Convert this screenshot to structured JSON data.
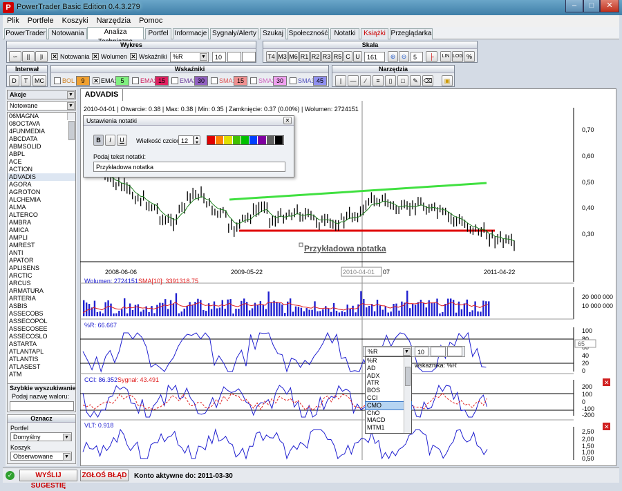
{
  "window": {
    "title": "PowerTrader Basic Edition 0.4.3.279"
  },
  "menu": [
    "Plik",
    "Portfele",
    "Koszyki",
    "Narzędzia",
    "Pomoc"
  ],
  "tabs": [
    "PowerTrader",
    "Notowania",
    "Analiza Techniczna",
    "Portfel",
    "Informacje",
    "Sygnały/Alerty",
    "Szukaj",
    "Społeczność",
    "Notatki",
    "Książki",
    "Przeglądarka"
  ],
  "wykres": {
    "title": "Wykres",
    "notowania": "Notowania",
    "wolumen": "Wolumen",
    "wskazniki": "Wskaźniki",
    "indicator": "%R",
    "period": "10"
  },
  "skala": {
    "title": "Skala",
    "buttons": [
      "T4",
      "M3",
      "M6",
      "R1",
      "R2",
      "R3",
      "R5",
      "C",
      "U"
    ],
    "count": "161",
    "zoom": "5",
    "lin": "LIN",
    "log": "LOG",
    "pct": "%"
  },
  "interwal": {
    "title": "Interwał",
    "buttons": [
      "D",
      "T",
      "MC"
    ]
  },
  "wskazniki_bar": {
    "title": "Wskaźniki",
    "items": [
      {
        "label": "BOL",
        "value": "9",
        "color": "#f0a030"
      },
      {
        "label": "EMA1",
        "value": "5",
        "color": "#70e070"
      },
      {
        "label": "EMA2",
        "value": "15",
        "color": "#e02060"
      },
      {
        "label": "EMA3",
        "value": "30",
        "color": "#9060c0"
      },
      {
        "label": "SMA1",
        "value": "15",
        "color": "#f07070"
      },
      {
        "label": "SMA2",
        "value": "30",
        "color": "#f080e0"
      },
      {
        "label": "SMA3",
        "value": "45",
        "color": "#7070e0"
      }
    ]
  },
  "narzedzia": {
    "title": "Narzędzia"
  },
  "left": {
    "akcje": "Akcje",
    "filter": "Notowane",
    "stocks": [
      "06MAGNA",
      "08OCTAVA",
      "4FUNMEDIA",
      "ABCDATA",
      "ABMSOLID",
      "ABPL",
      "ACE",
      "ACTION",
      "ADVADIS",
      "AGORA",
      "AGROTON",
      "ALCHEMIA",
      "ALMA",
      "ALTERCO",
      "AMBRA",
      "AMICA",
      "AMPLI",
      "AMREST",
      "ANTI",
      "APATOR",
      "APLISENS",
      "ARCTIC",
      "ARCUS",
      "ARMATURA",
      "ARTERIA",
      "ASBIS",
      "ASSECOBS",
      "ASSECOPOL",
      "ASSECOSEE",
      "ASSECOSLO",
      "ASTARTA",
      "ATLANTAPL",
      "ATLANTIS",
      "ATLASEST",
      "ATM"
    ],
    "selected": "ADVADIS",
    "quick_title": "Szybkie wyszukiwanie",
    "quick_prompt": "Podaj nazwę waloru:",
    "oznacz": "Oznacz",
    "portfel_label": "Portfel",
    "portfel_value": "Domyślny",
    "koszyk_label": "Koszyk",
    "koszyk_value": "Obserwowane"
  },
  "chart": {
    "tab": "ADVADIS",
    "info": "2010-04-01 | Otwarcie: 0.38 | Max: 0.38 | Min: 0.35 | Zamknięcie: 0.37 (0.00%) | Wolumen: 2724151",
    "yticks": [
      "0,70",
      "0,60",
      "0,50",
      "0,40",
      "0,30"
    ],
    "xticks": [
      "2008-06-06",
      "2009-05-22",
      "2010-04-01",
      "07",
      "2011-04-22"
    ],
    "note": "Przykładowa notatka",
    "volume_label": "Wolumen: 2724151",
    "volume_sma": "SMA[10]: 3391318.75",
    "volume_ticks": [
      "20 000 000",
      "10 000 000"
    ],
    "r_label": "%R: 66.667",
    "r_ticks": [
      "100",
      "80",
      "60",
      "40",
      "20",
      "0"
    ],
    "r_marker": "65",
    "cci_label": "CCI: 86.352",
    "cci_signal": "Sygnał: 43.491",
    "cci_ticks": [
      "200",
      "100",
      "0",
      "-100",
      "-200"
    ],
    "vlt_label": "VLT: 0.918",
    "vlt_ticks": [
      "2,50",
      "2,00",
      "1,50",
      "1,00",
      "0,50"
    ]
  },
  "dialog": {
    "title": "Ustawienia notatki",
    "font_label": "Wielkość czcionki:",
    "font_size": "12",
    "prompt": "Podaj tekst notatki:",
    "text": "Przykładowa notatka",
    "swatches": [
      "#e00000",
      "#ff8000",
      "#e0e000",
      "#40c000",
      "#00c000",
      "#0040ff",
      "#8000a0",
      "#606060",
      "#000000"
    ]
  },
  "indicator_popup": {
    "current": "%R",
    "period": "10",
    "suffix": "wskaźnika: %R",
    "options": [
      "%R",
      "AD",
      "ADX",
      "ATR",
      "BOS",
      "CCI",
      "CMO",
      "ChO",
      "MACD",
      "MTM1"
    ],
    "highlighted": "CMO"
  },
  "status": {
    "suggest": "WYŚLIJ SUGESTIĘ",
    "bug": "ZGŁOŚ BŁĄD",
    "account": "Konto aktywne do: 2011-03-30"
  }
}
